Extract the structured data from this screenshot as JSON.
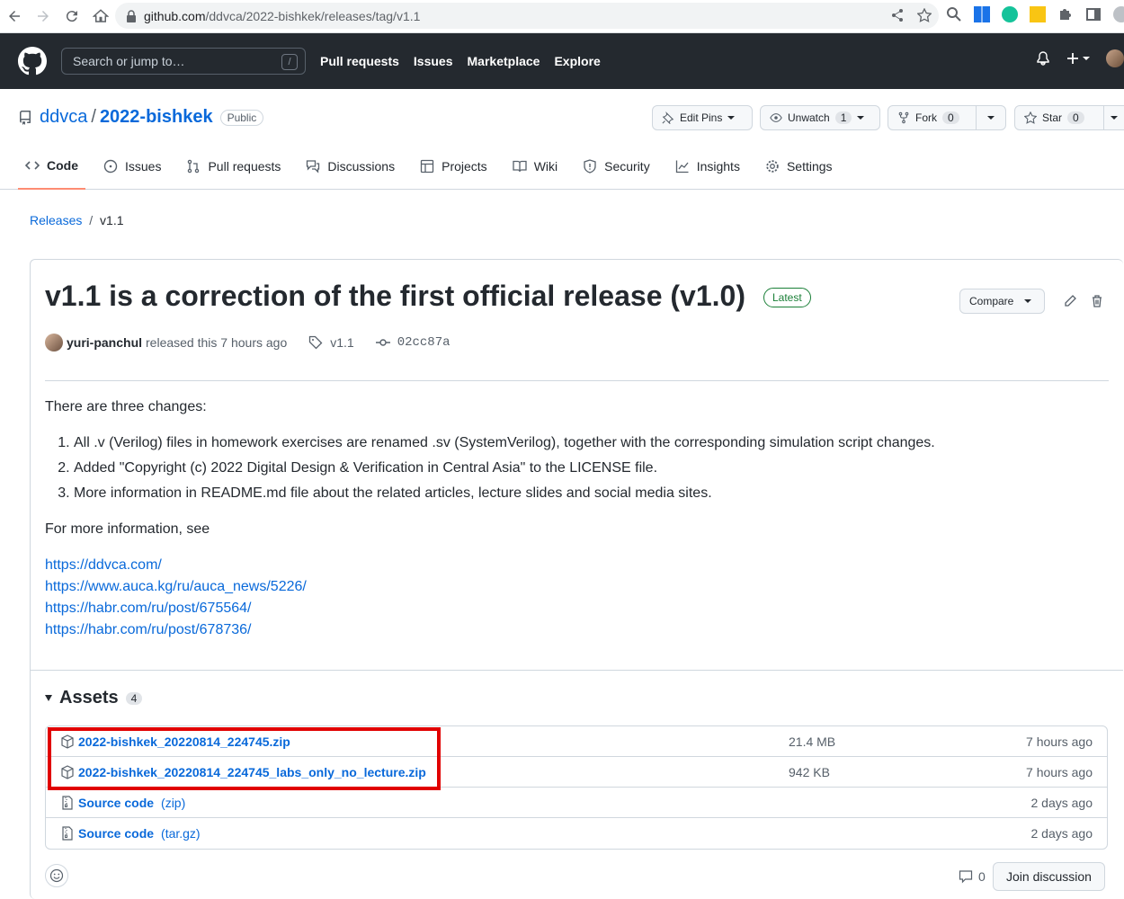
{
  "browser": {
    "url_domain": "github.com",
    "url_path": "/ddvca/2022-bishkek/releases/tag/v1.1"
  },
  "header": {
    "search_placeholder": "Search or jump to…",
    "search_shortcut": "/",
    "nav": [
      "Pull requests",
      "Issues",
      "Marketplace",
      "Explore"
    ]
  },
  "repo": {
    "owner": "ddvca",
    "separator": "/",
    "name": "2022-bishkek",
    "visibility": "Public",
    "actions": {
      "edit_pins": "Edit Pins",
      "unwatch": "Unwatch",
      "watch_count": "1",
      "fork": "Fork",
      "fork_count": "0",
      "star": "Star",
      "star_count": "0"
    },
    "tabs": [
      {
        "label": "Code",
        "icon": "code-icon"
      },
      {
        "label": "Issues",
        "icon": "issue-icon"
      },
      {
        "label": "Pull requests",
        "icon": "pull-request-icon"
      },
      {
        "label": "Discussions",
        "icon": "discussion-icon"
      },
      {
        "label": "Projects",
        "icon": "project-icon"
      },
      {
        "label": "Wiki",
        "icon": "book-icon"
      },
      {
        "label": "Security",
        "icon": "shield-icon"
      },
      {
        "label": "Insights",
        "icon": "graph-icon"
      },
      {
        "label": "Settings",
        "icon": "gear-icon"
      }
    ]
  },
  "breadcrumb": {
    "root": "Releases",
    "sep": "/",
    "current": "v1.1"
  },
  "release": {
    "title": "v1.1 is a correction of the first official release (v1.0)",
    "badge": "Latest",
    "compare": "Compare",
    "author": "yuri-panchul",
    "released_text": "released this 7 hours ago",
    "tag": "v1.1",
    "commit": "02cc87a",
    "intro": "There are three changes:",
    "changes": [
      "All .v (Verilog) files in homework exercises are renamed .sv (SystemVerilog), together with the corresponding simulation script changes.",
      "Added \"Copyright (c) 2022 Digital Design & Verification in Central Asia\" to the LICENSE file.",
      "More information in README.md file about the related articles, lecture slides and social media sites."
    ],
    "more_info": "For more information, see",
    "links": [
      "https://ddvca.com/",
      "https://www.auca.kg/ru/auca_news/5226/",
      "https://habr.com/ru/post/675564/",
      "https://habr.com/ru/post/678736/"
    ]
  },
  "assets": {
    "heading": "Assets",
    "count": "4",
    "rows": [
      {
        "name": "2022-bishkek_20220814_224745.zip",
        "format": "",
        "size": "21.4 MB",
        "time": "7 hours ago"
      },
      {
        "name": "2022-bishkek_20220814_224745_labs_only_no_lecture.zip",
        "format": "",
        "size": "942 KB",
        "time": "7 hours ago"
      },
      {
        "name": "Source code",
        "format": "(zip)",
        "size": "",
        "time": "2 days ago"
      },
      {
        "name": "Source code",
        "format": "(tar.gz)",
        "size": "",
        "time": "2 days ago"
      }
    ]
  },
  "footer": {
    "comment_count": "0",
    "join_label": "Join discussion"
  },
  "colors": {
    "highlight": "#e10000",
    "link": "#0969da",
    "header_bg": "#24292f"
  }
}
